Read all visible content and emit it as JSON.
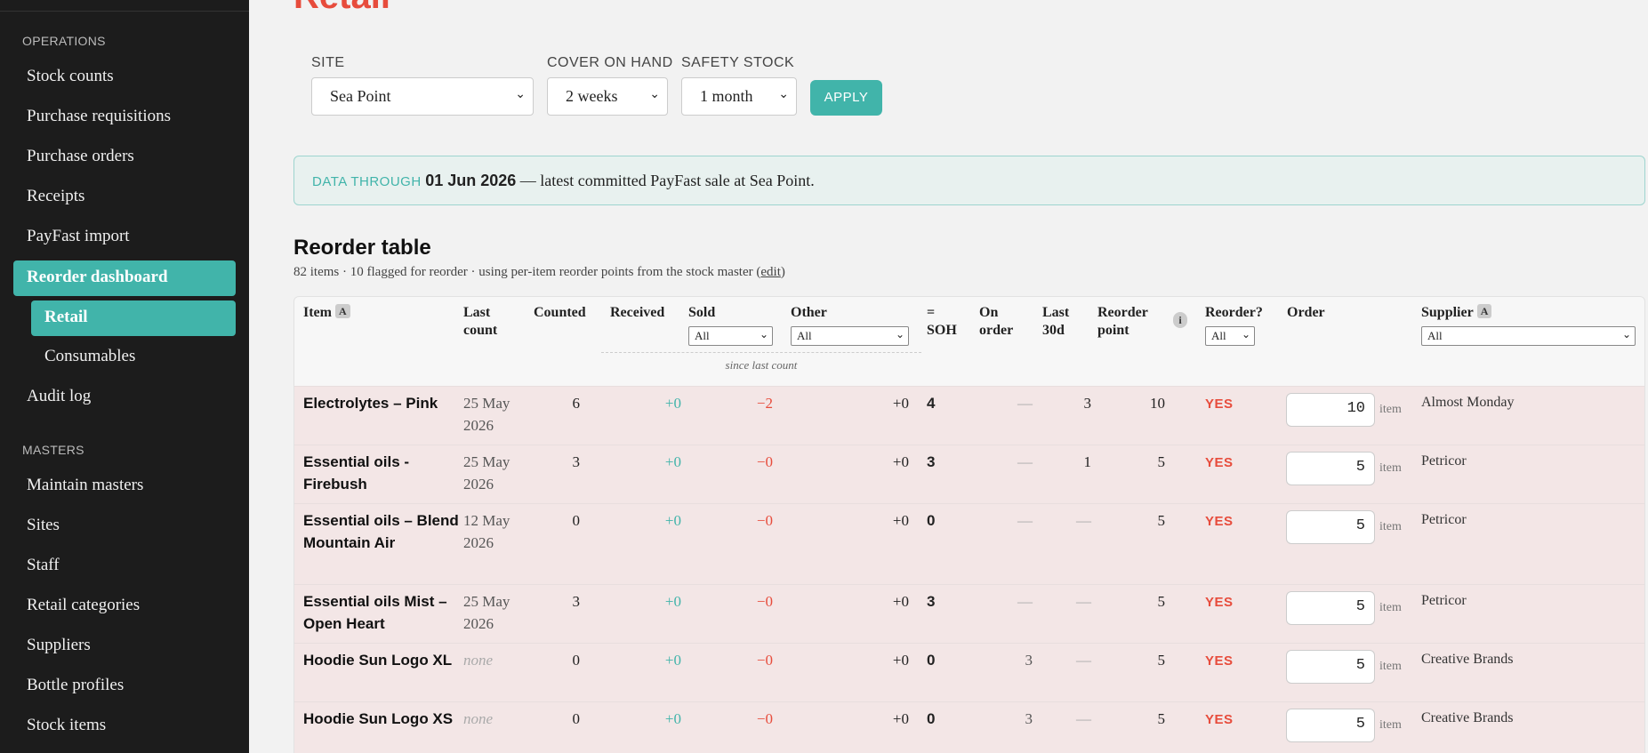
{
  "sidebar": {
    "section_operations": "OPERATIONS",
    "operations_items": [
      {
        "label": "Stock counts"
      },
      {
        "label": "Purchase requisitions"
      },
      {
        "label": "Purchase orders"
      },
      {
        "label": "Receipts"
      },
      {
        "label": "PayFast import"
      }
    ],
    "active_item": "Reorder dashboard",
    "active_sub": "Retail",
    "sub_consumables": "Consumables",
    "audit_log": "Audit log",
    "section_masters": "MASTERS",
    "masters_items": [
      {
        "label": "Maintain masters"
      },
      {
        "label": "Sites"
      },
      {
        "label": "Staff"
      },
      {
        "label": "Retail categories"
      },
      {
        "label": "Suppliers"
      },
      {
        "label": "Bottle profiles"
      },
      {
        "label": "Stock items"
      }
    ]
  },
  "page": {
    "title": "Retail"
  },
  "filters": {
    "site_label": "SITE",
    "site_value": "Sea Point",
    "cover_label": "COVER ON HAND",
    "cover_value": "2 weeks",
    "safety_label": "SAFETY STOCK",
    "safety_value": "1 month",
    "apply_label": "APPLY"
  },
  "banner": {
    "label": "DATA THROUGH",
    "date": "01 Jun 2026",
    "text": "— latest committed PayFast sale at Sea Point."
  },
  "reorder": {
    "title": "Reorder table",
    "subtitle_pre": "82 items · 10 flagged for reorder · using per-item reorder points from the stock master (",
    "edit_link": "edit",
    "subtitle_post": ")"
  },
  "table": {
    "headers": {
      "item": "Item",
      "item_badge": "A",
      "last_count_1": "Last",
      "last_count_2": "count",
      "counted": "Counted",
      "received": "Received",
      "sold": "Sold",
      "sold_filter": "All",
      "other": "Other",
      "other_filter": "All",
      "soh_1": "=",
      "soh_2": "SOH",
      "on_order_1": "On",
      "on_order_2": "order",
      "last30_1": "Last",
      "last30_2": "30d",
      "reorder_point_1": "Reorder",
      "reorder_point_2": "point",
      "info_icon": "i",
      "reorder_q": "Reorder?",
      "reorder_filter": "All",
      "order": "Order",
      "supplier": "Supplier",
      "supplier_badge": "A",
      "supplier_filter": "All",
      "since_last_count": "since last count"
    },
    "rows": [
      {
        "item": "Electrolytes – Pink",
        "last_count": "25 May 2026",
        "counted": "6",
        "received": "+0",
        "sold": "−2",
        "other": "+0",
        "soh": "4",
        "on_order": "—",
        "last30": "3",
        "reorder_point": "10",
        "reorder": "YES",
        "order": "10",
        "unit": "item",
        "supplier": "Almost Monday"
      },
      {
        "item": "Essential oils - Firebush",
        "last_count": "25 May 2026",
        "counted": "3",
        "received": "+0",
        "sold": "−0",
        "other": "+0",
        "soh": "3",
        "on_order": "—",
        "last30": "1",
        "reorder_point": "5",
        "reorder": "YES",
        "order": "5",
        "unit": "item",
        "supplier": "Petricor"
      },
      {
        "item": "Essential oils – Blend Mountain Air",
        "last_count": "12 May 2026",
        "counted": "0",
        "received": "+0",
        "sold": "−0",
        "other": "+0",
        "soh": "0",
        "on_order": "—",
        "last30": "—",
        "reorder_point": "5",
        "reorder": "YES",
        "order": "5",
        "unit": "item",
        "supplier": "Petricor"
      },
      {
        "item": "Essential oils Mist – Open Heart",
        "last_count": "25 May 2026",
        "counted": "3",
        "received": "+0",
        "sold": "−0",
        "other": "+0",
        "soh": "3",
        "on_order": "—",
        "last30": "—",
        "reorder_point": "5",
        "reorder": "YES",
        "order": "5",
        "unit": "item",
        "supplier": "Petricor"
      },
      {
        "item": "Hoodie Sun Logo XL",
        "last_count": "none",
        "counted": "0",
        "received": "+0",
        "sold": "−0",
        "other": "+0",
        "soh": "0",
        "on_order": "3",
        "last30": "—",
        "reorder_point": "5",
        "reorder": "YES",
        "order": "5",
        "unit": "item",
        "supplier": "Creative Brands"
      },
      {
        "item": "Hoodie Sun Logo XS",
        "last_count": "none",
        "counted": "0",
        "received": "+0",
        "sold": "−0",
        "other": "+0",
        "soh": "0",
        "on_order": "3",
        "last30": "—",
        "reorder_point": "5",
        "reorder": "YES",
        "order": "5",
        "unit": "item",
        "supplier": "Creative Brands"
      }
    ]
  }
}
